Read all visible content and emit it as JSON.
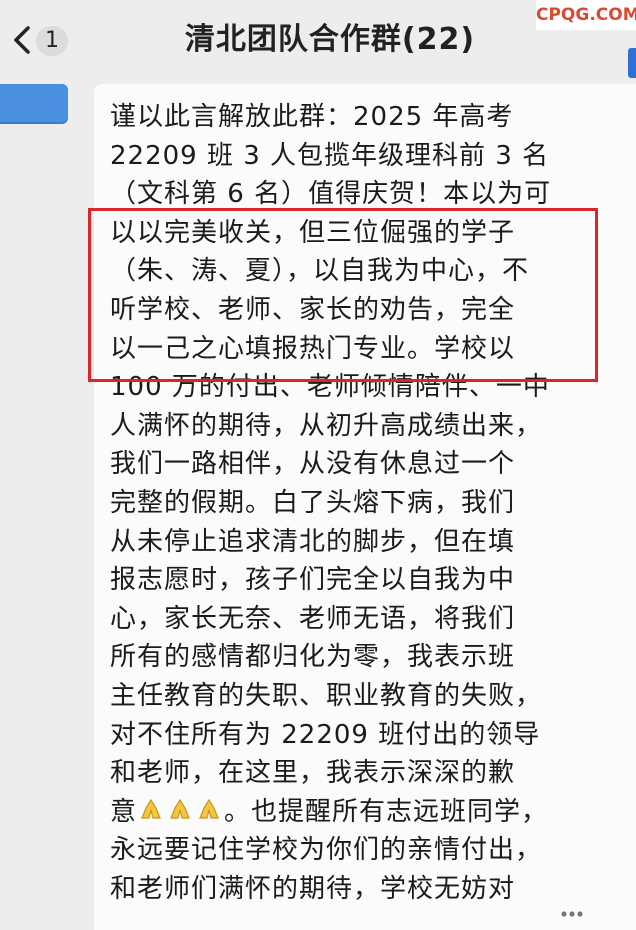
{
  "header": {
    "title": "清北团队合作群(22)",
    "back_icon": "chevron-left-icon",
    "unread_count": "1"
  },
  "watermark": "CPQG.COM",
  "message": {
    "lines": [
      "谨以此言解放此群：2025 年高考",
      "22209 班 3 人包揽年级理科前 3 名",
      "（文科第 6 名）值得庆贺！本以为可",
      "以以完美收关，但三位倔强的学子",
      "（朱、涛、夏），以自我为中心，不",
      "听学校、老师、家长的劝告，完全",
      "以一己之心填报热门专业。学校以",
      "100 万的付出、老师倾情陪伴、一中",
      "人满怀的期待，从初升高成绩出来，",
      "我们一路相伴，从没有休息过一个",
      "完整的假期。白了头熔下病，我们",
      "从未停止追求清北的脚步，但在填",
      "报志愿时，孩子们完全以自我为中",
      "心，家长无奈、老师无语，将我们",
      "所有的感情都归化为零，我表示班",
      "主任教育的失职、职业教育的失败，",
      "对不住所有为 22209 班付出的领导",
      "和老师，在这里，我表示深深的歉",
      "。也提醒所有志远班同学，",
      "永远要记住学校为你们的亲情付出，",
      "和老师们满怀的期待，学校无妨对"
    ],
    "line18_prefix": "意",
    "emoji": [
      "folded-hands-emoji",
      "folded-hands-emoji",
      "folded-hands-emoji"
    ]
  },
  "colors": {
    "highlight_box": "#d9262c",
    "watermark": "#d84a34",
    "avatar": "#4a8fe0"
  }
}
